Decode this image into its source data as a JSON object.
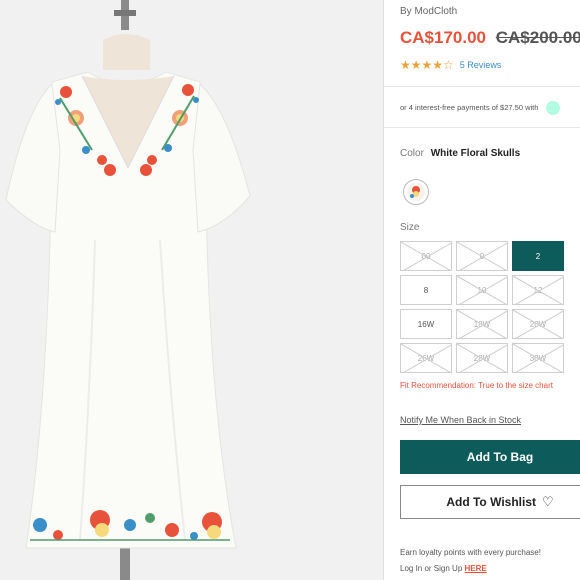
{
  "product": {
    "image_alt": "White floral embroidered v-neck dress on mannequin",
    "brand": "By ModCloth",
    "sale_price": "CA$170.00",
    "original_price": "CA$200.00",
    "rating": 4,
    "reviews": "5 Reviews",
    "installments": "or 4 interest-free payments of $27.50 with"
  },
  "color": {
    "label": "Color",
    "value": "White Floral Skulls"
  },
  "size": {
    "label": "Size",
    "options": [
      {
        "label": "00",
        "available": false
      },
      {
        "label": "0",
        "available": false
      },
      {
        "label": "2",
        "available": true,
        "selected": true
      },
      {
        "label": "8",
        "available": true
      },
      {
        "label": "10",
        "available": false
      },
      {
        "label": "12",
        "available": false
      },
      {
        "label": "16W",
        "available": true
      },
      {
        "label": "18W",
        "available": false
      },
      {
        "label": "20W",
        "available": false
      },
      {
        "label": "26W",
        "available": false
      },
      {
        "label": "28W",
        "available": false
      },
      {
        "label": "30W",
        "available": false
      }
    ],
    "fit": "Fit Recommendation: True to the size chart"
  },
  "actions": {
    "notify": "Notify Me When Back in Stock",
    "add_to_bag": "Add To Bag",
    "add_to_wishlist": "Add To Wishlist"
  },
  "loyalty": {
    "text": "Earn loyalty points with every purchase!",
    "login": "Log In or Sign Up",
    "here": "HERE"
  },
  "colors": {
    "accent": "#0d5b5a",
    "sale": "#e8523a",
    "star": "#e8a33a",
    "link": "#3a8fc8"
  }
}
